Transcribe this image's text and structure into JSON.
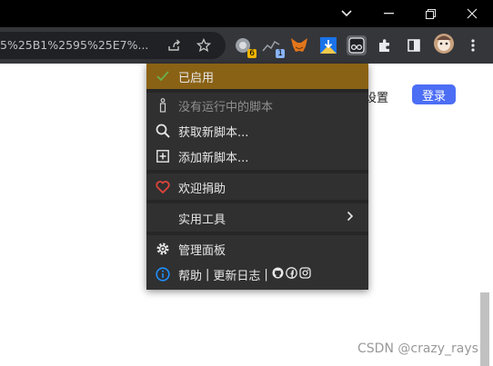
{
  "browser": {
    "url_fragment": "5%25B1%2595%25E7%...",
    "extension_badges": {
      "ext1": "6",
      "ext2": "1"
    }
  },
  "page": {
    "settings_label": "设置",
    "login_label": "登录",
    "watermark": "CSDN @crazy_rays"
  },
  "menu": {
    "enabled_label": "已启用",
    "no_scripts_label": "没有运行中的脚本",
    "get_scripts_label": "获取新脚本...",
    "add_script_label": "添加新脚本...",
    "donate_label": "欢迎捐助",
    "utilities_label": "实用工具",
    "dashboard_label": "管理面板",
    "help_label": "帮助",
    "changelog_label": "更新日志",
    "separator": "|"
  },
  "colors": {
    "menu_bg": "#303030",
    "enabled_bg": "#8a6215",
    "check": "#6ab04c",
    "heart": "#e0443b",
    "info": "#1e90ff",
    "login_bg": "#4c6ef5"
  },
  "icons": [
    "minimize-icon",
    "restore-icon",
    "close-icon",
    "chevron-down-icon",
    "share-icon",
    "star-icon",
    "puzzle-icon",
    "sidepanel-icon",
    "more-icon",
    "check-icon",
    "tampermonkey-icon",
    "search-icon",
    "plus-square-icon",
    "heart-icon",
    "chevron-right-icon",
    "gear-icon",
    "info-icon",
    "github-icon",
    "facebook-icon",
    "instagram-icon"
  ]
}
